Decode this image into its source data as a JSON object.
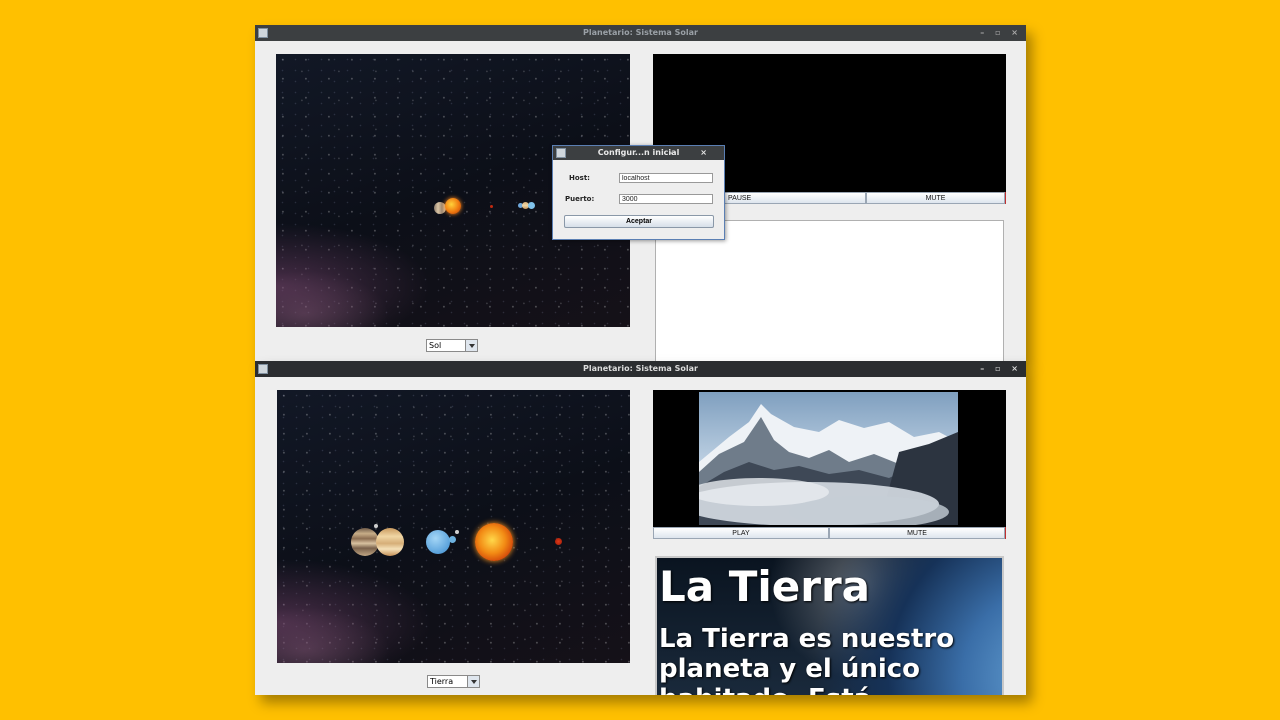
{
  "window_top": {
    "title": "Planetario: Sistema Solar",
    "controls": "– ▫ ×",
    "selector_value": "Sol",
    "buttons": {
      "left": "PAUSE",
      "right": "MUTE"
    }
  },
  "dialog": {
    "title": "Configur...n inicial",
    "controls": "– ×",
    "host_label": "Host:",
    "host_value": "localhost",
    "port_label": "Puerto:",
    "port_value": "3000",
    "accept_label": "Aceptar"
  },
  "window_bottom": {
    "title": "Planetario: Sistema Solar",
    "controls": "– ▫ ×",
    "selector_value": "Tierra",
    "buttons": {
      "left": "PLAY",
      "right": "MUTE"
    },
    "info": {
      "title": "La Tierra",
      "text": "La Tierra es nuestro planeta y el único habitado. Está"
    }
  },
  "colors": {
    "background": "#FFC000",
    "titlebar": "#3c3f41",
    "panel": "#eeeeee"
  }
}
